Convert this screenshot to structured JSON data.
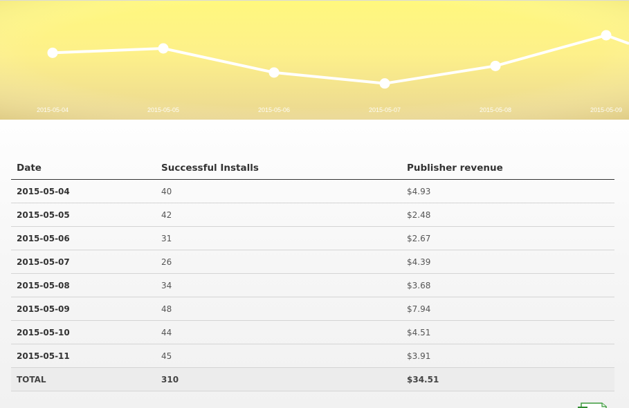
{
  "chart_data": {
    "type": "line",
    "x": [
      "2015-05-04",
      "2015-05-05",
      "2015-05-06",
      "2015-05-07",
      "2015-05-08",
      "2015-05-09"
    ],
    "values": [
      40,
      42,
      31,
      26,
      34,
      48
    ],
    "ylim": [
      0,
      60
    ],
    "grid": false,
    "colors": {
      "line": "#ffffff",
      "background_top": "#fff783",
      "background_bottom": "#ecd890"
    }
  },
  "table": {
    "headers": {
      "date": "Date",
      "installs": "Successful Installs",
      "revenue": "Publisher revenue"
    },
    "rows": [
      {
        "date": "2015-05-04",
        "installs": "40",
        "revenue": "$4.93"
      },
      {
        "date": "2015-05-05",
        "installs": "42",
        "revenue": "$2.48"
      },
      {
        "date": "2015-05-06",
        "installs": "31",
        "revenue": "$2.67"
      },
      {
        "date": "2015-05-07",
        "installs": "26",
        "revenue": "$4.39"
      },
      {
        "date": "2015-05-08",
        "installs": "34",
        "revenue": "$3.68"
      },
      {
        "date": "2015-05-09",
        "installs": "48",
        "revenue": "$7.94"
      },
      {
        "date": "2015-05-10",
        "installs": "44",
        "revenue": "$4.51"
      },
      {
        "date": "2015-05-11",
        "installs": "45",
        "revenue": "$3.91"
      }
    ],
    "total": {
      "label": "TOTAL",
      "installs": "310",
      "revenue": "$34.51"
    }
  },
  "icons": {
    "export": "spreadsheet-export-icon"
  }
}
